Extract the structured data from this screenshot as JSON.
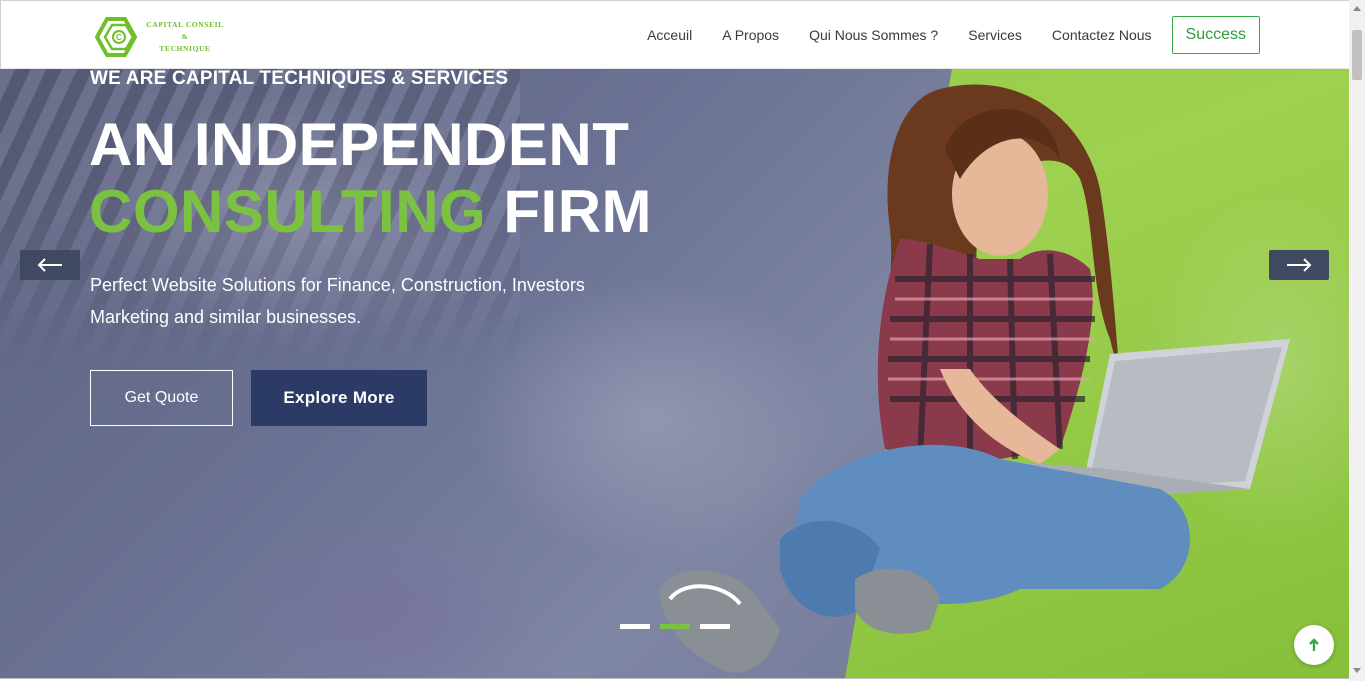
{
  "header": {
    "logo": {
      "text_line1": "CAPITAL CONSEIL",
      "text_line2": "&",
      "text_line3": "TECHNIQUE",
      "logo_icon": "hexagon-c-logo"
    },
    "nav": [
      {
        "label": "Acceuil"
      },
      {
        "label": "A Propos"
      },
      {
        "label": "Qui Nous Sommes ?"
      },
      {
        "label": "Services"
      },
      {
        "label": "Contactez Nous"
      }
    ],
    "cta_label": "Success"
  },
  "hero": {
    "kicker": "WE ARE CAPITAL TECHNIQUES & SERVICES",
    "title_line1": "AN INDEPENDENT",
    "title_accent": "CONSULTING",
    "title_rest": "FIRM",
    "subtitle": "Perfect Website Solutions for Finance, Construction, Investors Marketing and similar businesses.",
    "button_primary": "Get Quote",
    "button_secondary": "Explore More",
    "prev_icon": "arrow-left-icon",
    "next_icon": "arrow-right-icon",
    "slides": 3,
    "active_slide": 2
  },
  "back_to_top_icon": "arrow-up-icon",
  "colors": {
    "accent_green": "#7bc142",
    "nav_button": "#3aa64a",
    "dark_blue": "#2c3a66",
    "panel_green": "#8cc63f"
  }
}
